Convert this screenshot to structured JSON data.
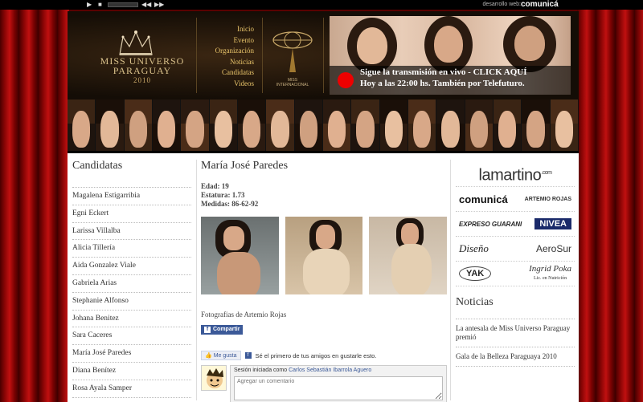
{
  "topbar": {
    "credit_label": "desarrollo web:",
    "credit_brand": "comunicá"
  },
  "header": {
    "logo_title": "MISS UNIVERSO",
    "logo_subtitle": "PARAGUAY",
    "logo_year": "2010",
    "nav": [
      "Inicio",
      "Evento",
      "Organización",
      "Noticias",
      "Candidatas",
      "Videos"
    ],
    "mi_label_1": "MISS",
    "mi_label_2": "INTERNACIONAL",
    "banner_line1": "Sigue la transmisión en vivo - CLICK AQUÍ",
    "banner_line2": "Hoy a las 22:00 hs. También por Telefuturo."
  },
  "candidates": {
    "title": "Candidatas",
    "items": [
      "Magalena Estigarribia",
      "Egni Eckert",
      "Larissa Villalba",
      "Alicia Tillería",
      "Aida Gonzalez Viale",
      "Gabriela Arias",
      "Stephanie Alfonso",
      "Johana Benitez",
      "Sara Caceres",
      "María José Paredes",
      "Diana Benítez",
      "Rosa Ayala Samper"
    ]
  },
  "profile": {
    "name": "María José Paredes",
    "age_label": "Edad:",
    "age": "19",
    "height_label": "Estatura:",
    "height": "1.73",
    "measures_label": "Medidas:",
    "measures": "86-62-92",
    "photo_credit": "Fotografias de Artemio Rojas",
    "share_label": "Compartir",
    "like_label": "Me gusta",
    "like_text": "Sé el primero de tus amigos en gustarle esto.",
    "session_label": "Sesión iniciada como",
    "session_user": "Carlos Sebastián Ibarrola Aguero",
    "comment_placeholder": "Agregar un comentario"
  },
  "sponsors": {
    "lamartino": "lamartino",
    "lamartino_sup": ".com",
    "row1": [
      "comunicá",
      "ARTEMIO ROJAS"
    ],
    "row2": [
      "EXPRESO GUARANI",
      "NIVEA"
    ],
    "row3": [
      "Diseño",
      "AeroSur"
    ],
    "row4": [
      "YAK",
      "Ingrid Poka"
    ],
    "row4_sub": "Lic. en Nutrición"
  },
  "news": {
    "title": "Noticias",
    "items": [
      "La antesala de Miss Universo Paraguay premió",
      "Gala de la Belleza Paraguaya 2010"
    ]
  },
  "colors": {
    "curtain": "#a00808",
    "nav_gold": "#e8c46a",
    "facebook": "#3b5998",
    "live_red": "#ee0000"
  }
}
